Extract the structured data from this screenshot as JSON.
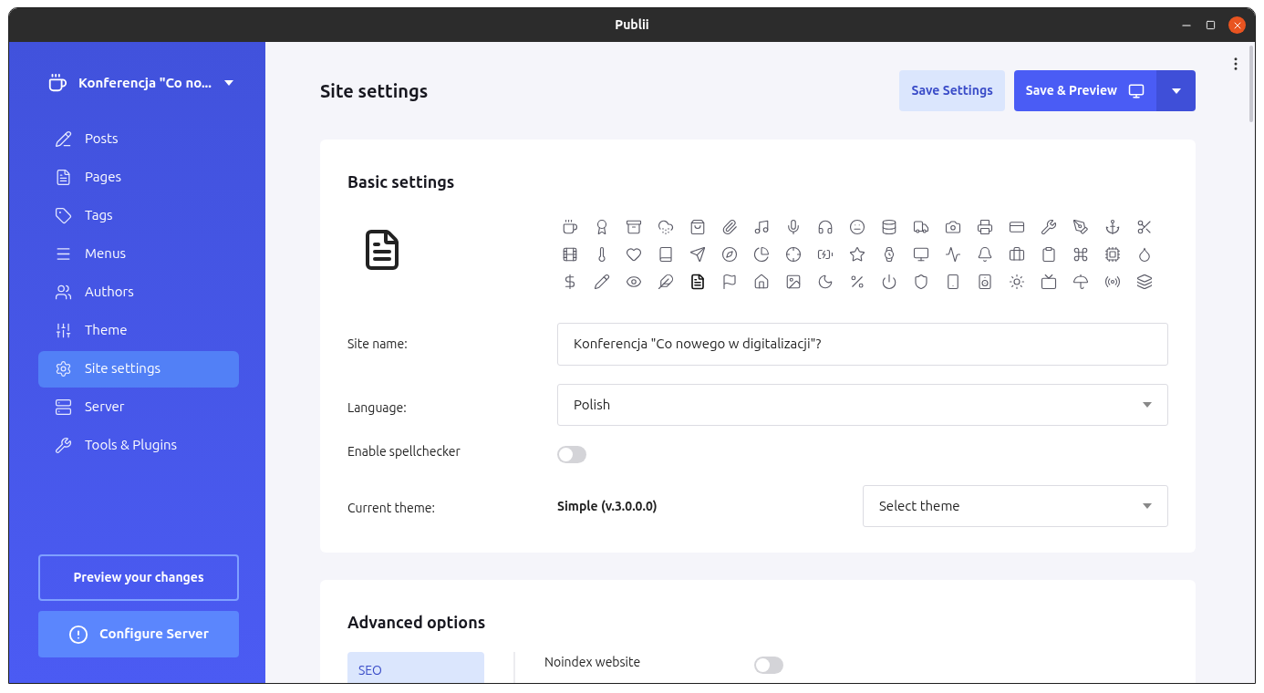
{
  "window": {
    "title": "Publii"
  },
  "sidebar": {
    "site_name": "Konferencja \"Co no...",
    "items": [
      {
        "label": "Posts",
        "selected": false
      },
      {
        "label": "Pages",
        "selected": false
      },
      {
        "label": "Tags",
        "selected": false
      },
      {
        "label": "Menus",
        "selected": false
      },
      {
        "label": "Authors",
        "selected": false
      },
      {
        "label": "Theme",
        "selected": false
      },
      {
        "label": "Site settings",
        "selected": true
      },
      {
        "label": "Server",
        "selected": false
      },
      {
        "label": "Tools & Plugins",
        "selected": false
      }
    ],
    "preview_button": "Preview your changes",
    "configure_button": "Configure Server"
  },
  "header": {
    "title": "Site settings",
    "save_button": "Save Settings",
    "save_preview_button": "Save & Preview"
  },
  "basic_settings": {
    "title": "Basic settings",
    "icons": [
      {
        "selected": false
      },
      {
        "selected": false
      },
      {
        "selected": false
      },
      {
        "selected": false
      },
      {
        "selected": false
      },
      {
        "selected": false
      },
      {
        "selected": false
      },
      {
        "selected": false
      },
      {
        "selected": false
      },
      {
        "selected": false
      },
      {
        "selected": false
      },
      {
        "selected": false
      },
      {
        "selected": false
      },
      {
        "selected": false
      },
      {
        "selected": false
      },
      {
        "selected": false
      },
      {
        "selected": false
      },
      {
        "selected": false
      },
      {
        "selected": false
      },
      {
        "selected": false
      },
      {
        "selected": false
      },
      {
        "selected": false
      },
      {
        "selected": false
      },
      {
        "selected": false
      },
      {
        "selected": false
      },
      {
        "selected": false
      },
      {
        "selected": false
      },
      {
        "selected": false
      },
      {
        "selected": false
      },
      {
        "selected": false
      },
      {
        "selected": false
      },
      {
        "selected": false
      },
      {
        "selected": false
      },
      {
        "selected": false
      },
      {
        "selected": false
      },
      {
        "selected": false
      },
      {
        "selected": false
      },
      {
        "selected": false
      },
      {
        "selected": false
      },
      {
        "selected": false
      },
      {
        "selected": false
      },
      {
        "selected": false
      },
      {
        "selected": true
      },
      {
        "selected": false
      },
      {
        "selected": false
      },
      {
        "selected": false
      },
      {
        "selected": false
      },
      {
        "selected": false
      },
      {
        "selected": false
      },
      {
        "selected": false
      },
      {
        "selected": false
      },
      {
        "selected": false
      },
      {
        "selected": false
      },
      {
        "selected": false
      },
      {
        "selected": false
      },
      {
        "selected": false
      },
      {
        "selected": false
      }
    ],
    "site_name": {
      "label": "Site name:",
      "value": "Konferencja \"Co nowego w digitalizacji\"?"
    },
    "language": {
      "label": "Language:",
      "value": "Polish"
    },
    "spellchecker": {
      "label": "Enable spellchecker",
      "on": false
    },
    "current_theme": {
      "label": "Current theme:",
      "value": "Simple (v.3.0.0.0)",
      "select": "Select theme"
    }
  },
  "advanced_options": {
    "title": "Advanced options",
    "tabs": [
      {
        "label": "SEO",
        "selected": true
      }
    ],
    "noindex": {
      "label": "Noindex website",
      "on": false
    }
  }
}
